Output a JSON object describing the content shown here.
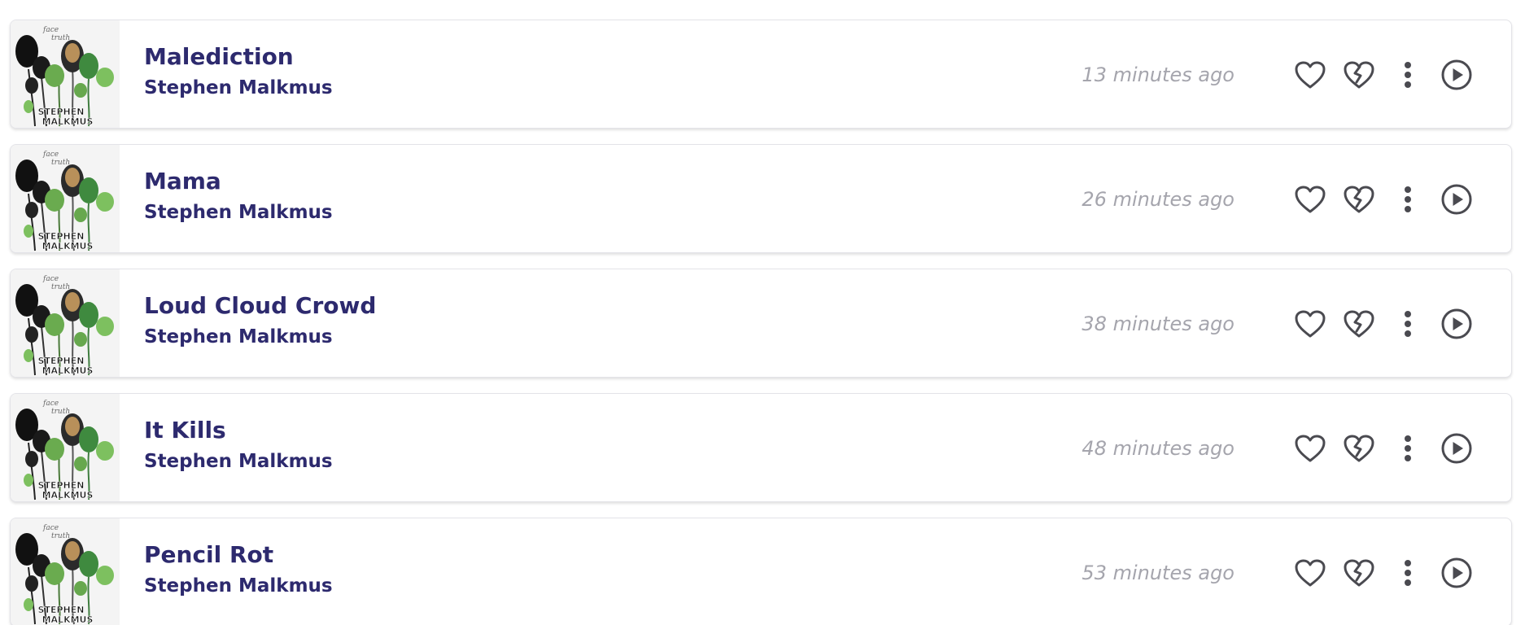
{
  "colors": {
    "title": "#2d2a6e",
    "timestamp": "#a5a5ad",
    "icon": "#4a4a50",
    "border": "#e3e3e8"
  },
  "album_art": {
    "label_top": "face",
    "label_top2": "truth",
    "artist_lettering": "STEPHEN MALKMUS"
  },
  "tracks": [
    {
      "title": "Malediction",
      "artist": "Stephen Malkmus",
      "time": "13 minutes ago"
    },
    {
      "title": "Mama",
      "artist": "Stephen Malkmus",
      "time": "26 minutes ago"
    },
    {
      "title": "Loud Cloud Crowd",
      "artist": "Stephen Malkmus",
      "time": "38 minutes ago"
    },
    {
      "title": "It Kills",
      "artist": "Stephen Malkmus",
      "time": "48 minutes ago"
    },
    {
      "title": "Pencil Rot",
      "artist": "Stephen Malkmus",
      "time": "53 minutes ago"
    }
  ],
  "icons": {
    "love": "heart-icon",
    "unlove": "broken-heart-icon",
    "menu": "more-vertical-icon",
    "play": "play-circle-icon"
  }
}
